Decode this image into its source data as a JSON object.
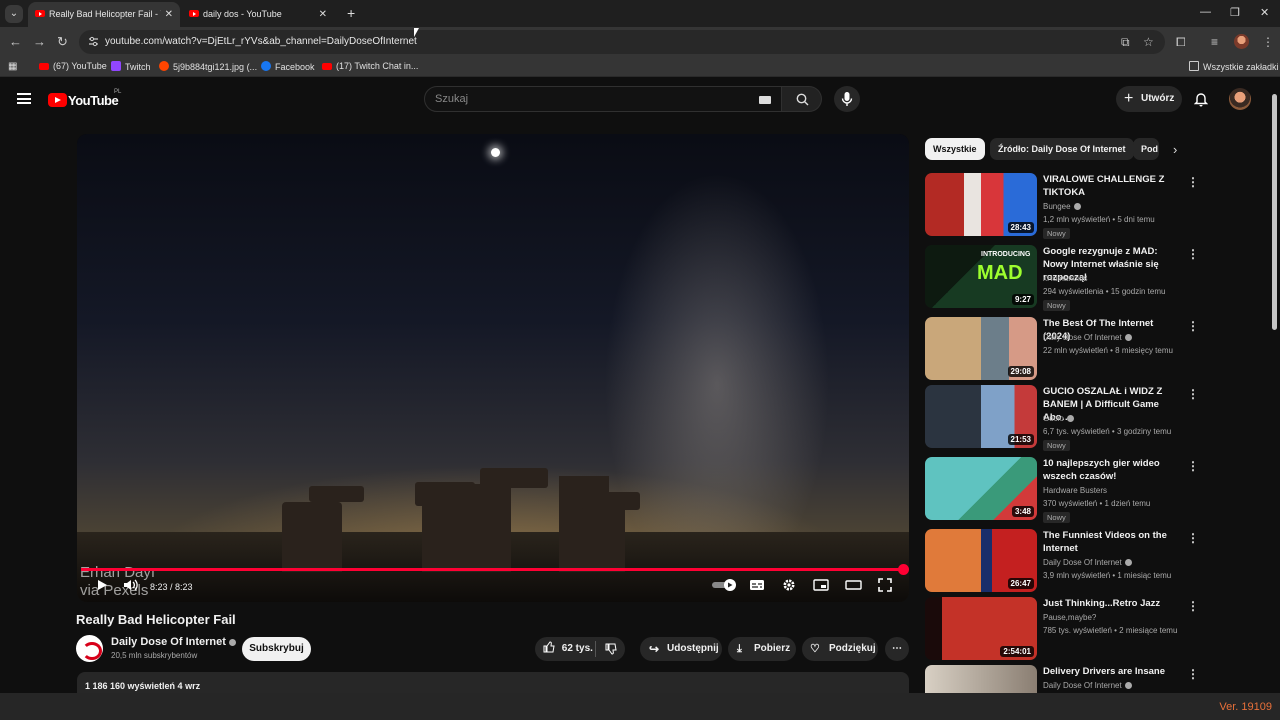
{
  "browser": {
    "tabs": [
      {
        "title": "Really Bad Helicopter Fail - YouTube",
        "active": true
      },
      {
        "title": "daily dos - YouTube",
        "active": false
      }
    ],
    "url": "youtube.com/watch?v=DjEtLr_rYVs&ab_channel=DailyDoseOfInternet",
    "bookmarks": [
      "(67) YouTube",
      "Twitch",
      "5j9b884tgi121.jpg (...",
      "Facebook",
      "(17) Twitch Chat in...",
      "Wszystkie zakładki"
    ]
  },
  "youtube": {
    "logo": "YouTube",
    "country": "PL",
    "search_placeholder": "Szukaj",
    "create_label": "Utwórz"
  },
  "player": {
    "watermark_line1": "Erhan Dayı",
    "watermark_line2": "via Pexels",
    "time": "8:23 / 8:23",
    "progress_fraction": 1.0
  },
  "video": {
    "title": "Really Bad Helicopter Fail",
    "channel": "Daily Dose Of Internet",
    "subscribers": "20,5 mln subskrybentów",
    "subscribe_label": "Subskrybuj",
    "likes": "62 tys.",
    "share_label": "Udostępnij",
    "download_label": "Pobierz",
    "thanks_label": "Podziękuj",
    "description_stats": "1 186 160 wyświetleń  4 wrz"
  },
  "chips": [
    "Wszystkie",
    "Źródło: Daily Dose Of Internet",
    "Pod"
  ],
  "recommendations": [
    {
      "title": "VIRALOWE CHALLENGE Z TIKTOKA",
      "channel": "Bungee",
      "meta": "1,2 mln wyświetleń • 5 dni temu",
      "badge": "Nowy",
      "duration": "28:43",
      "verified": true
    },
    {
      "title": "Google rezygnuje z MAD: Nowy Internet właśnie się rozpoczął",
      "channel": "xHumanoids",
      "meta": "294 wyświetlenia • 15 godzin temu",
      "badge": "Nowy",
      "duration": "9:27",
      "verified": false
    },
    {
      "title": "The Best Of The Internet (2024)",
      "channel": "Daily Dose Of Internet",
      "meta": "22 mln wyświetleń • 8 miesięcy temu",
      "badge": "",
      "duration": "29:08",
      "verified": true
    },
    {
      "title": "GUCIO OSZALAŁ i WIDZ Z BANEM | A Difficult Game Abo…",
      "channel": "Gucio",
      "meta": "6,7 tys. wyświetleń • 3 godziny temu",
      "badge": "Nowy",
      "duration": "21:53",
      "verified": true
    },
    {
      "title": "10 najlepszych gier wideo wszech czasów!",
      "channel": "Hardware Busters",
      "meta": "370 wyświetleń • 1 dzień temu",
      "badge": "Nowy",
      "duration": "3:48",
      "verified": false
    },
    {
      "title": "The Funniest Videos on the Internet",
      "channel": "Daily Dose Of Internet",
      "meta": "3,9 mln wyświetleń • 1 miesiąc temu",
      "badge": "",
      "duration": "26:47",
      "verified": true
    },
    {
      "title": "Just Thinking...Retro Jazz",
      "channel": "Pause,maybe?",
      "meta": "785 tys. wyświetleń • 2 miesiące temu",
      "badge": "",
      "duration": "2:54:01",
      "verified": false
    },
    {
      "title": "Delivery Drivers are Insane",
      "channel": "Daily Dose Of Internet",
      "meta": "",
      "badge": "",
      "duration": "",
      "verified": true
    }
  ],
  "version": "Ver. 19109"
}
